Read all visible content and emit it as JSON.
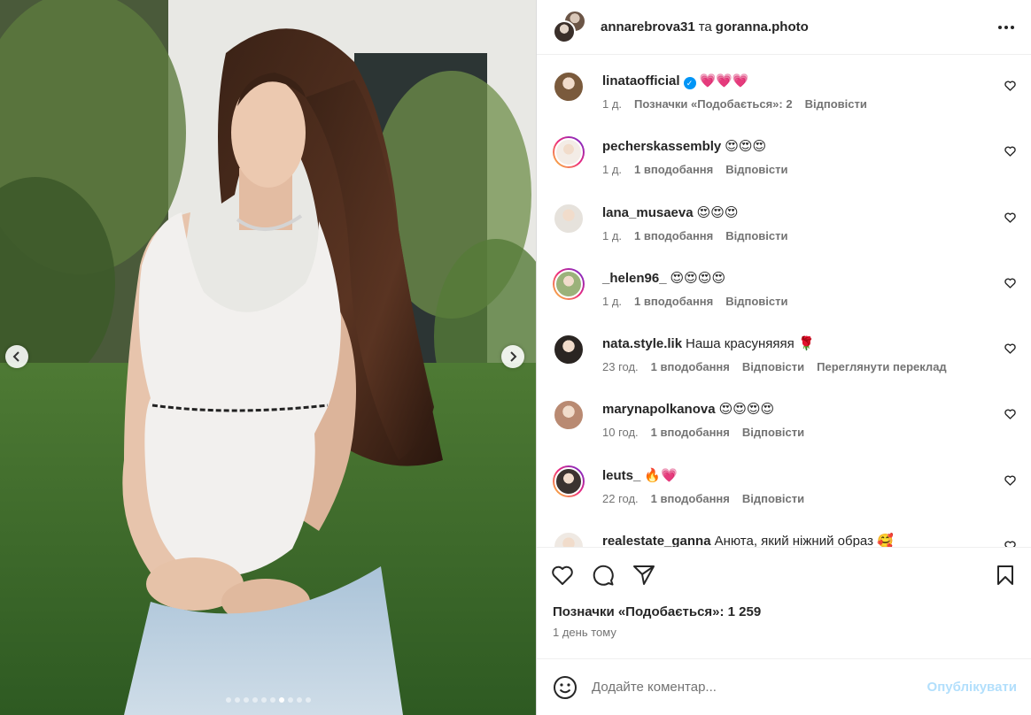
{
  "carousel": {
    "dot_count": 10,
    "active_index": 6,
    "prev_icon": "chevron-left-icon",
    "next_icon": "chevron-right-icon"
  },
  "header": {
    "author": "annarebrova31",
    "separator": "та",
    "collaborator": "goranna.photo",
    "more_icon": "more-horizontal-icon"
  },
  "comments": [
    {
      "user": "linataofficial",
      "verified": true,
      "text": "💗💗💗",
      "time": "1 д.",
      "likes": "Позначки «Подобається»: 2",
      "reply": "Відповісти",
      "translate": "",
      "story_ring": false,
      "avatar_color": "#7a5a3c"
    },
    {
      "user": "pecherskassembly",
      "verified": false,
      "text": "😍😍😍",
      "time": "1 д.",
      "likes": "1 вподобання",
      "reply": "Відповісти",
      "translate": "",
      "story_ring": true,
      "avatar_color": "#f3ece6"
    },
    {
      "user": "lana_musaeva",
      "verified": false,
      "text": "😍😍😍",
      "time": "1 д.",
      "likes": "1 вподобання",
      "reply": "Відповісти",
      "translate": "",
      "story_ring": false,
      "avatar_color": "#e6e2dc"
    },
    {
      "user": "_helen96_",
      "verified": false,
      "text": "😍😍😍😍",
      "time": "1 д.",
      "likes": "1 вподобання",
      "reply": "Відповісти",
      "translate": "",
      "story_ring": true,
      "avatar_color": "#9bb27a"
    },
    {
      "user": "nata.style.lik",
      "verified": false,
      "text": "Наша красуняяяя 🌹",
      "time": "23 год.",
      "likes": "1 вподобання",
      "reply": "Відповісти",
      "translate": "Переглянути переклад",
      "story_ring": false,
      "avatar_color": "#2a2522"
    },
    {
      "user": "marynapolkanova",
      "verified": false,
      "text": "😍😍😍😍",
      "time": "10 год.",
      "likes": "1 вподобання",
      "reply": "Відповісти",
      "translate": "",
      "story_ring": false,
      "avatar_color": "#b98a72"
    },
    {
      "user": "leuts_",
      "verified": false,
      "text": "🔥💗",
      "time": "22 год.",
      "likes": "1 вподобання",
      "reply": "Відповісти",
      "translate": "",
      "story_ring": true,
      "avatar_color": "#3b3330"
    },
    {
      "user": "realestate_ganna",
      "verified": false,
      "text": "Анюта, який ніжний образ 🥰",
      "time": "",
      "likes": "",
      "reply": "",
      "translate": "",
      "story_ring": false,
      "avatar_color": "#efe9e3"
    }
  ],
  "actions": {
    "like_icon": "heart-outline-icon",
    "comment_icon": "comment-bubble-icon",
    "share_icon": "paper-plane-icon",
    "save_icon": "bookmark-icon"
  },
  "likes_text": "Позначки «Подобається»: 1 259",
  "time_ago": "1 день тому",
  "comment_box": {
    "emoji_icon": "smiley-icon",
    "placeholder": "Додайте коментар...",
    "post_label": "Опублікувати"
  }
}
